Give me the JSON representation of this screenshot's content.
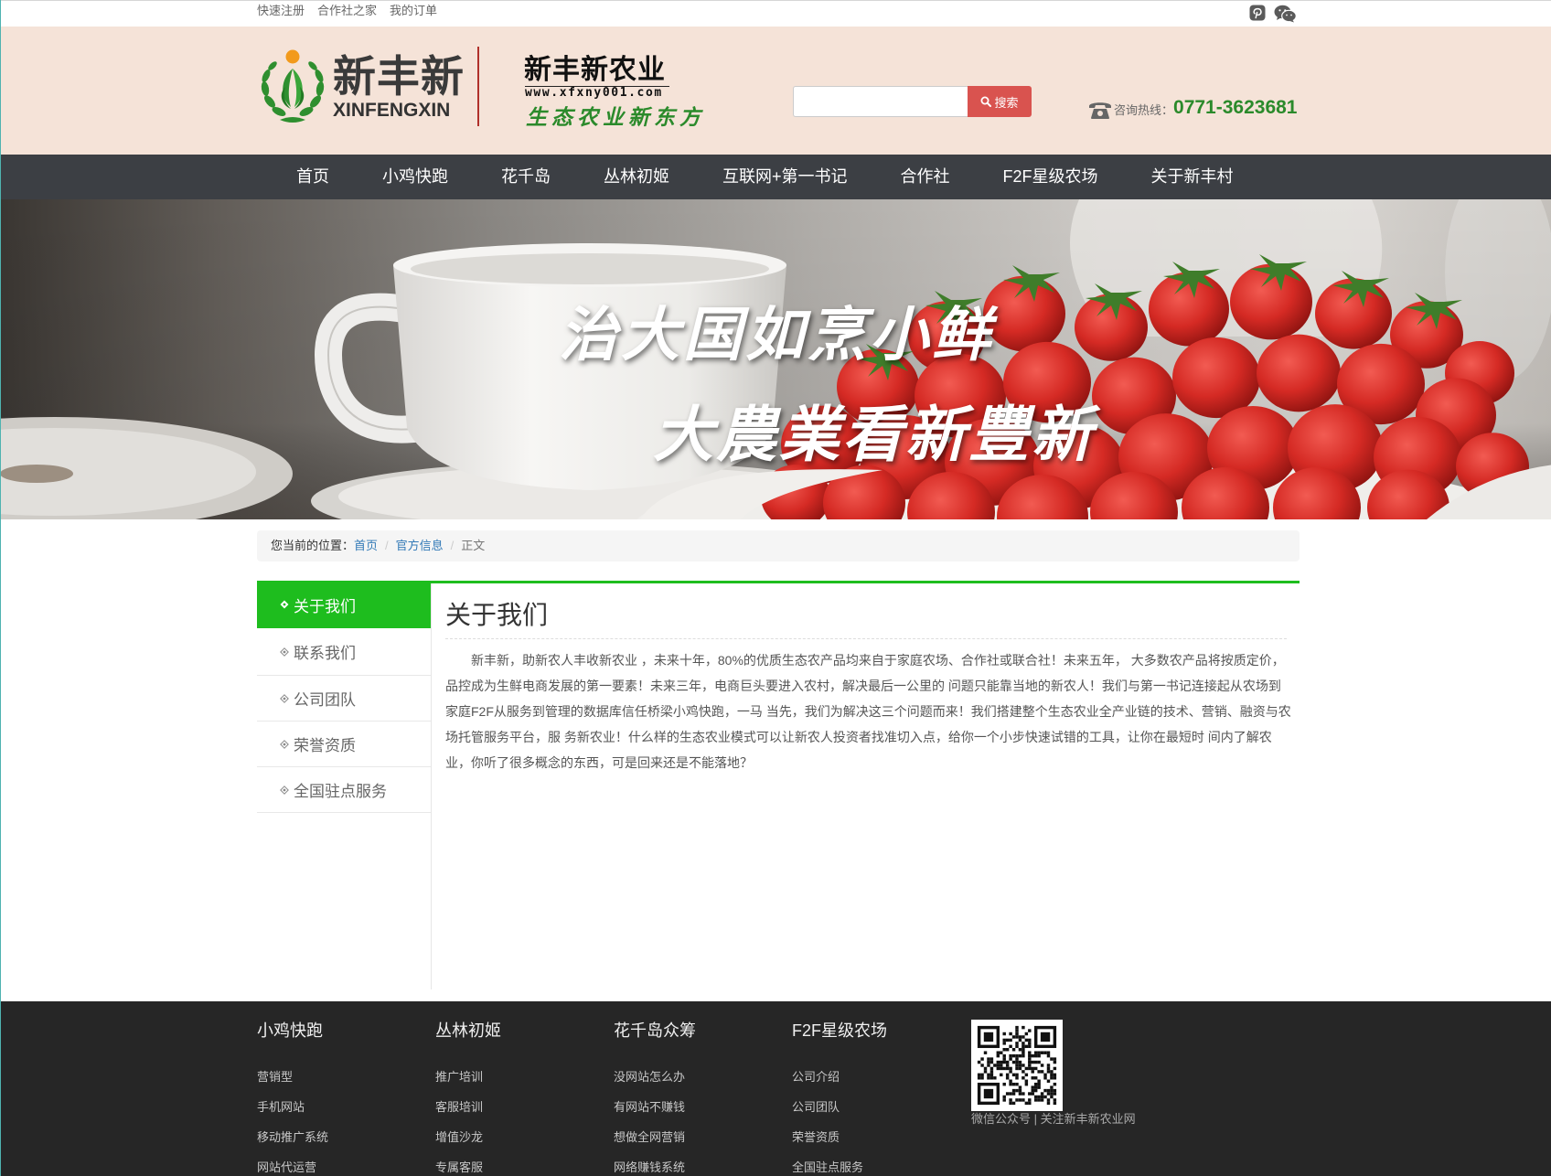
{
  "topbar": {
    "links": [
      "快速注册",
      "合作社之家",
      "我的订单"
    ],
    "icons": [
      "pinterest-icon",
      "wechat-icon"
    ]
  },
  "header": {
    "logo_cn": "新丰新",
    "logo_en": "XINFENGXIN",
    "brand_title": "新丰新农业",
    "brand_url": "www.xfxny001.com",
    "brand_slogan": "生态农业新东方",
    "search_button": "搜索",
    "hotline_label": "咨询热线：",
    "hotline_number": "0771-3623681"
  },
  "nav": [
    "首页",
    "小鸡快跑",
    "花千岛",
    "丛林初姬",
    "互联网+第一书记",
    "合作社",
    "F2F星级农场",
    "关于新丰村"
  ],
  "banner": {
    "line1": "治大国如烹小鲜",
    "line2": "大農業看新豐新"
  },
  "breadcrumb": {
    "prefix": "您当前的位置：",
    "separator": "/",
    "items": [
      "首页",
      "官方信息",
      "正文"
    ]
  },
  "sidebar": {
    "items": [
      "关于我们",
      "联系我们",
      "公司团队",
      "荣誉资质",
      "全国驻点服务"
    ],
    "active": "关于我们"
  },
  "article": {
    "title": "关于我们",
    "body": "新丰新，助新农人丰收新农业 ，未来十年，80%的优质生态农产品均来自于家庭农场、合作社或联合社！未来五年， 大多数农产品将按质定价，品控成为生鲜电商发展的第一要素！未来三年，电商巨头要进入农村，解决最后一公里的 问题只能靠当地的新农人！我们与第一书记连接起从农场到家庭F2F从服务到管理的数据库信任桥梁小鸡快跑，一马 当先，我们为解决这三个问题而来！我们搭建整个生态农业全产业链的技术、营销、融资与农场托管服务平台，服 务新农业！什么样的生态农业模式可以让新农人投资者找准切入点，给你一个小步快速试错的工具，让你在最短时 间内了解农业，你听了很多概念的东西，可是回来还是不能落地？"
  },
  "footer": {
    "columns": [
      {
        "title": "小鸡快跑",
        "links": [
          "营销型",
          "手机网站",
          "移动推广系统",
          "网站代运营"
        ]
      },
      {
        "title": "丛林初姬",
        "links": [
          "推广培训",
          "客服培训",
          "增值沙龙",
          "专属客服"
        ]
      },
      {
        "title": "花千岛众筹",
        "links": [
          "没网站怎么办",
          "有网站不赚钱",
          "想做全网营销",
          "网络赚钱系统"
        ]
      },
      {
        "title": "F2F星级农场",
        "links": [
          "公司介绍",
          "公司团队",
          "荣誉资质",
          "全国驻点服务"
        ]
      }
    ],
    "qr_caption": "微信公众号 | 关注新丰新农业网"
  },
  "colors": {
    "accent_green": "#1ebd1e",
    "nav_bg": "#3c3f44",
    "header_bg": "#f5e3d8",
    "search_button": "#d9534f",
    "hotline": "#2b8a2b",
    "footer_bg": "#262626",
    "link_blue": "#337ab7"
  }
}
